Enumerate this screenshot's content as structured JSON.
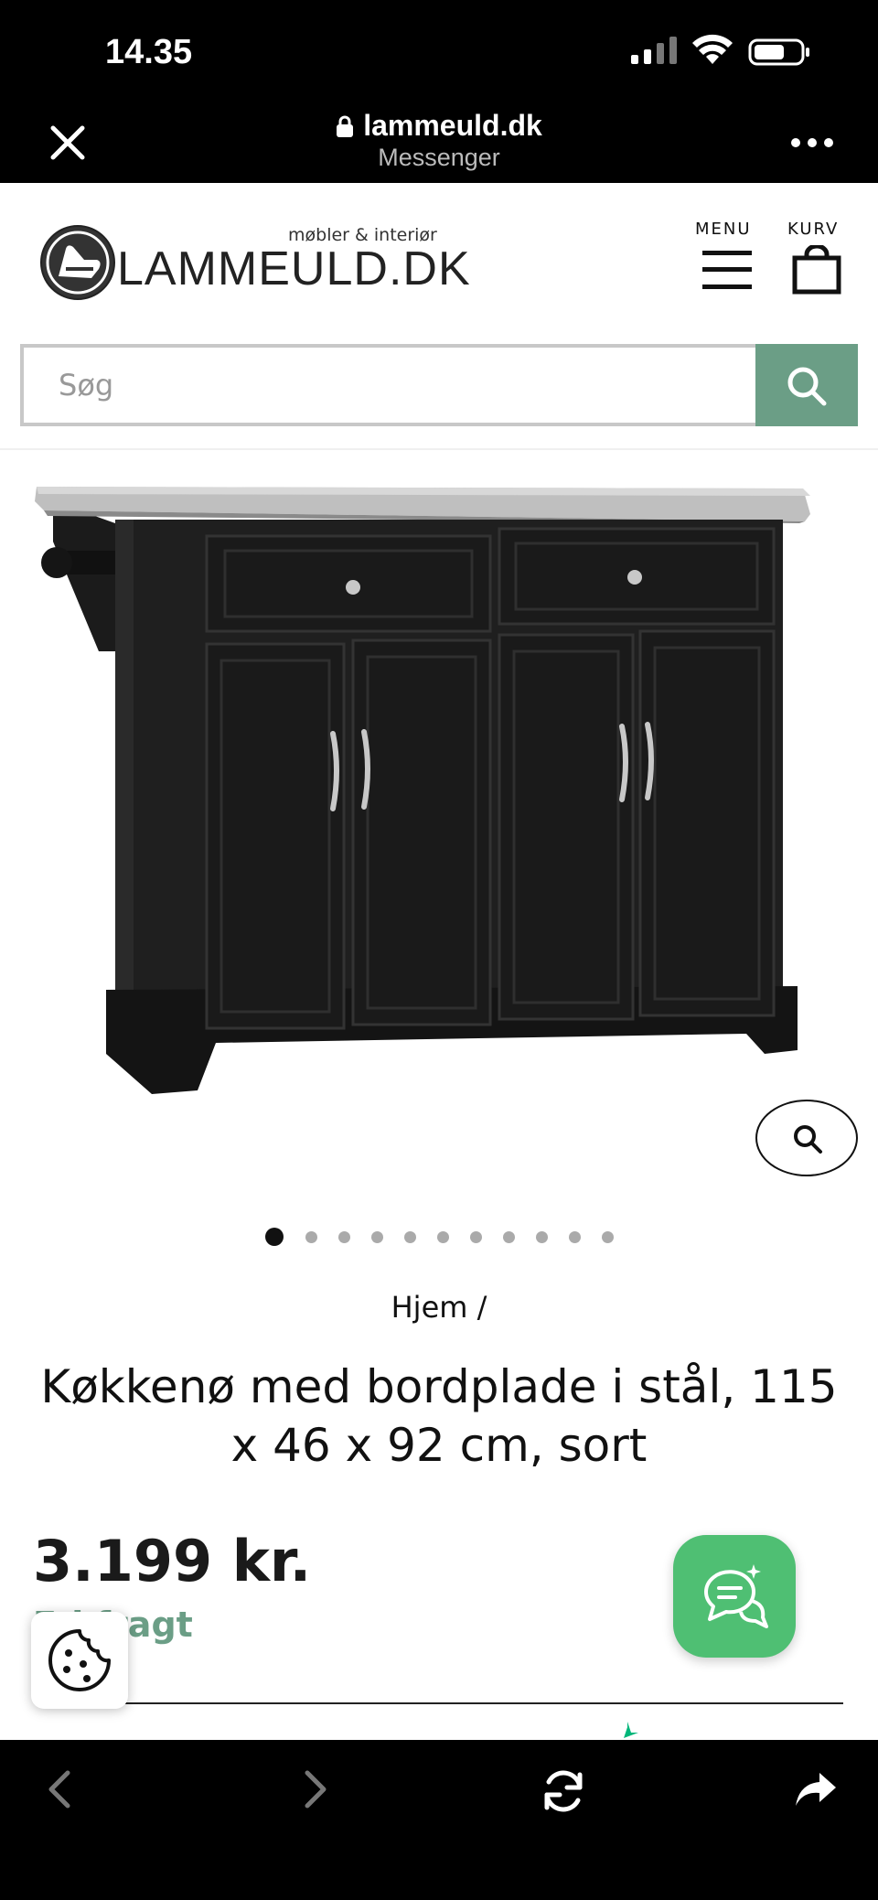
{
  "status_bar": {
    "time": "14.35",
    "icons": [
      "cellular-signal-icon",
      "wifi-icon",
      "battery-icon"
    ]
  },
  "browser_bar": {
    "url": "lammeuld.dk",
    "subtitle": "Messenger",
    "icons": [
      "close-icon",
      "lock-icon",
      "more-icon"
    ]
  },
  "header": {
    "logo_text": "LAMMEULD.DK",
    "tagline": "møbler & interiør",
    "menu_label": "MENU",
    "cart_label": "KURV"
  },
  "search": {
    "placeholder": "Søg"
  },
  "gallery": {
    "image_count": 11,
    "active_index": 0
  },
  "product": {
    "breadcrumb": "Hjem /",
    "title": "Køkkenø med bordplade i stål, 115 x 46 x 92 cm, sort",
    "price": "3.199 kr.",
    "shipping": "Fri fragt"
  },
  "colors": {
    "accent": "#6b9e86",
    "chat": "#4fbf73",
    "bar": "#000000"
  },
  "toolbar": {
    "icons": [
      "back-icon",
      "forward-icon",
      "reload-icon",
      "share-icon"
    ]
  }
}
